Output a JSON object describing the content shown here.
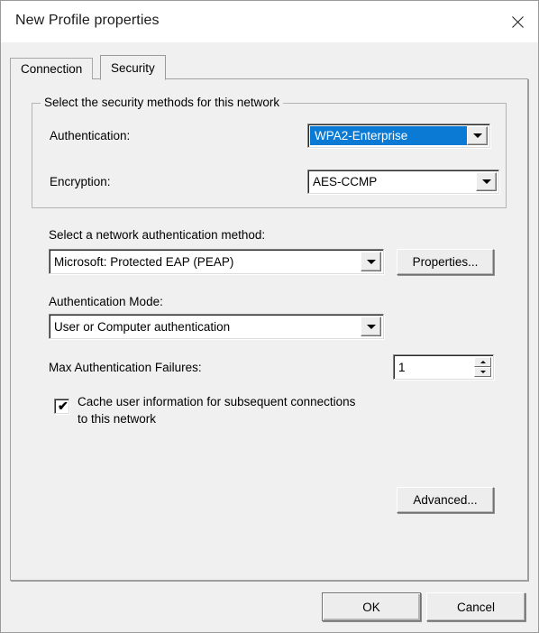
{
  "window": {
    "title": "New Profile properties",
    "close_icon": "close-icon"
  },
  "tabs": [
    {
      "label": "Connection",
      "active": false
    },
    {
      "label": "Security",
      "active": true
    }
  ],
  "colors": {
    "highlight": "#0a7ad4",
    "dialog_face": "#f0f0f0",
    "field_bg": "#ffffff"
  },
  "security": {
    "groupbox": {
      "title": "Select the security methods for this network",
      "authentication": {
        "label": "Authentication:",
        "value": "WPA2-Enterprise",
        "selected": true
      },
      "encryption": {
        "label": "Encryption:",
        "value": "AES-CCMP",
        "selected": false
      }
    },
    "auth_method": {
      "label": "Select a network authentication method:",
      "value": "Microsoft: Protected EAP (PEAP)",
      "properties_button": "Properties..."
    },
    "auth_mode": {
      "label": "Authentication Mode:",
      "value": "User or Computer authentication"
    },
    "max_failures": {
      "label": "Max Authentication Failures:",
      "value": "1"
    },
    "cache_checkbox": {
      "label": "Cache user information for subsequent connections\nto this network",
      "checked": true,
      "glyph": "✔"
    },
    "advanced_button": "Advanced..."
  },
  "footer": {
    "ok_label": "OK",
    "cancel_label": "Cancel"
  }
}
